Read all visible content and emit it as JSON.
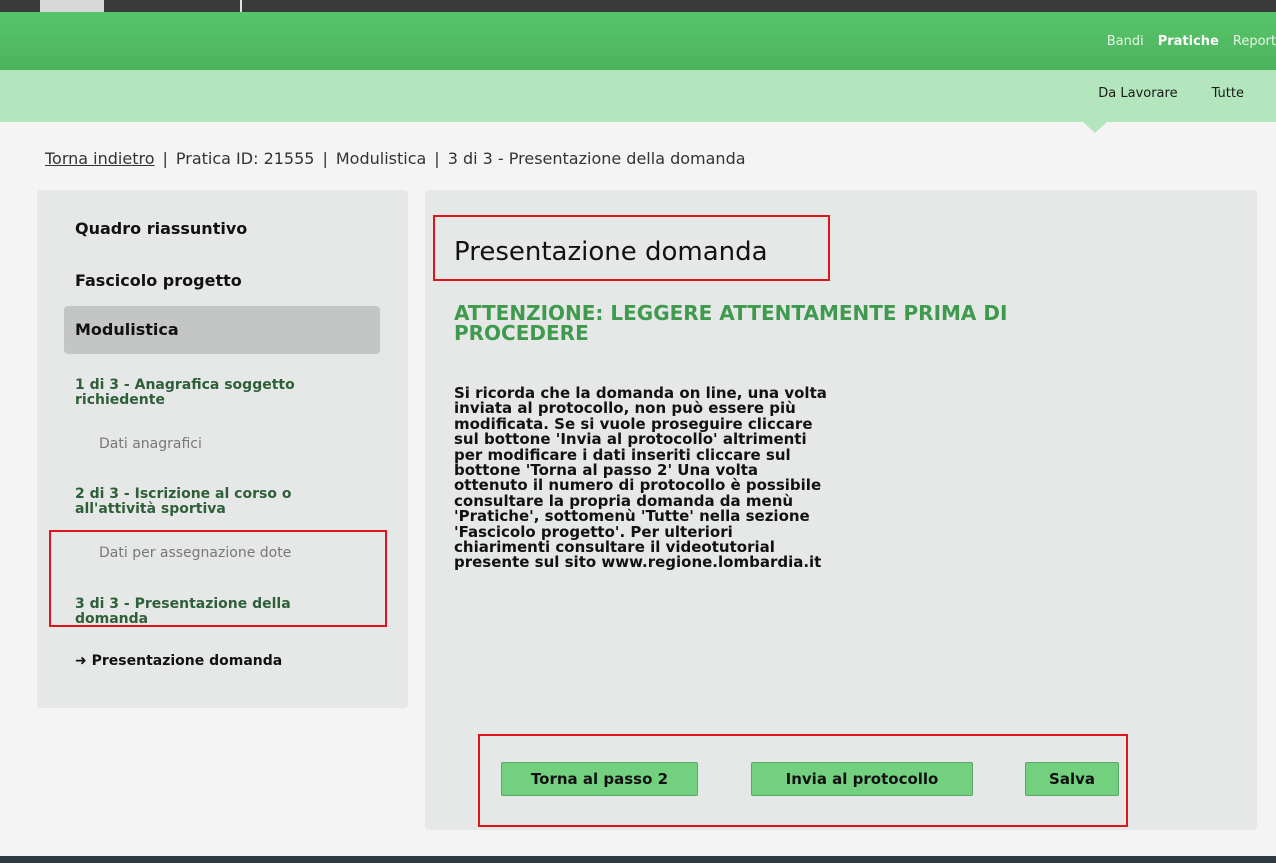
{
  "top_nav": {
    "items": [
      "Bandi",
      "Pratiche",
      "Report"
    ]
  },
  "sub_nav": {
    "items": [
      "Da Lavorare",
      "Tutte"
    ]
  },
  "breadcrumb": {
    "back": "Torna indietro",
    "sep": "|",
    "pratica": "Pratica ID: 21555",
    "section": "Modulistica",
    "step": "3 di 3 - Presentazione della domanda"
  },
  "sidebar": {
    "quadro": "Quadro riassuntivo",
    "fascicolo": "Fascicolo progetto",
    "modulistica": "Modulistica",
    "step1": "1 di 3 - Anagrafica soggetto richiedente",
    "step1_sub": "Dati anagrafici",
    "step2": "2 di 3 - Iscrizione al corso o all'attività sportiva",
    "step2_sub": "Dati per assegnazione dote",
    "step3": "3 di 3 - Presentazione della domanda",
    "current": "Presentazione domanda"
  },
  "main": {
    "title": "Presentazione domanda",
    "warning": "ATTENZIONE: LEGGERE ATTENTAMENTE PRIMA DI PROCEDERE",
    "body": "Si ricorda che la domanda on line, una volta inviata al protocollo, non può essere più modificata. Se si vuole proseguire cliccare sul bottone 'Invia al protocollo' altrimenti per modificare i dati inseriti cliccare sul bottone 'Torna al passo 2' Una volta ottenuto il numero di protocollo è possibile consultare la propria domanda da menù 'Pratiche', sottomenù 'Tutte' nella sezione 'Fascicolo progetto'. Per ulteriori chiarimenti consultare il videotutorial presente sul sito www.regione.lombardia.it"
  },
  "buttons": {
    "back": "Torna al passo 2",
    "send": "Invia al protocollo",
    "save": "Salva"
  },
  "colors": {
    "header_green": "#58c56a",
    "subheader_green": "#b3e6bd",
    "button_green": "#72d07f",
    "warning_green": "#3f9a4e",
    "highlight_red": "#e0141d"
  }
}
